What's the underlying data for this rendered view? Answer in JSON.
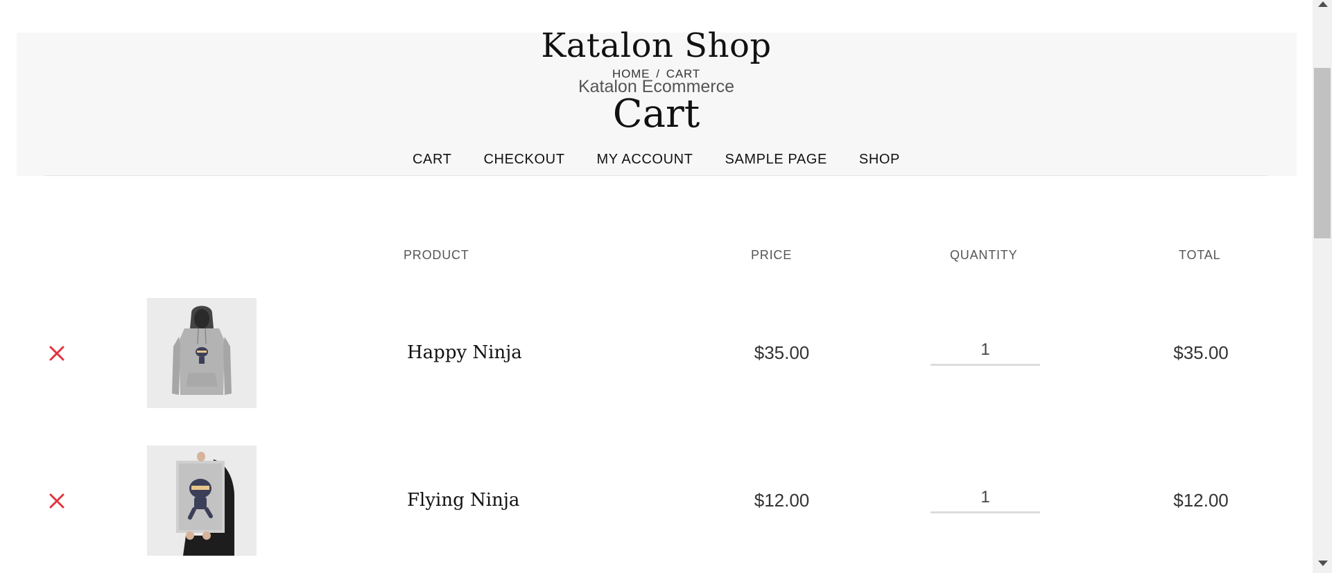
{
  "header": {
    "site_title": "Katalon Shop",
    "breadcrumb": {
      "home": "HOME",
      "separator": "/",
      "current": "CART"
    },
    "tagline": "Katalon Ecommerce",
    "page_title": "Cart"
  },
  "nav": {
    "items": [
      {
        "label": "CART"
      },
      {
        "label": "CHECKOUT"
      },
      {
        "label": "MY ACCOUNT"
      },
      {
        "label": "SAMPLE PAGE"
      },
      {
        "label": "SHOP"
      }
    ]
  },
  "cart": {
    "columns": {
      "product": "PRODUCT",
      "price": "PRICE",
      "quantity": "QUANTITY",
      "total": "TOTAL"
    },
    "items": [
      {
        "name": "Happy Ninja",
        "price": "$35.00",
        "quantity": "1",
        "total": "$35.00",
        "image_icon": "hoodie-image"
      },
      {
        "name": "Flying Ninja",
        "price": "$12.00",
        "quantity": "1",
        "total": "$12.00",
        "image_icon": "poster-image"
      }
    ]
  },
  "colors": {
    "remove": "#e2343f",
    "header_band": "#f7f7f7",
    "text": "#111111"
  }
}
